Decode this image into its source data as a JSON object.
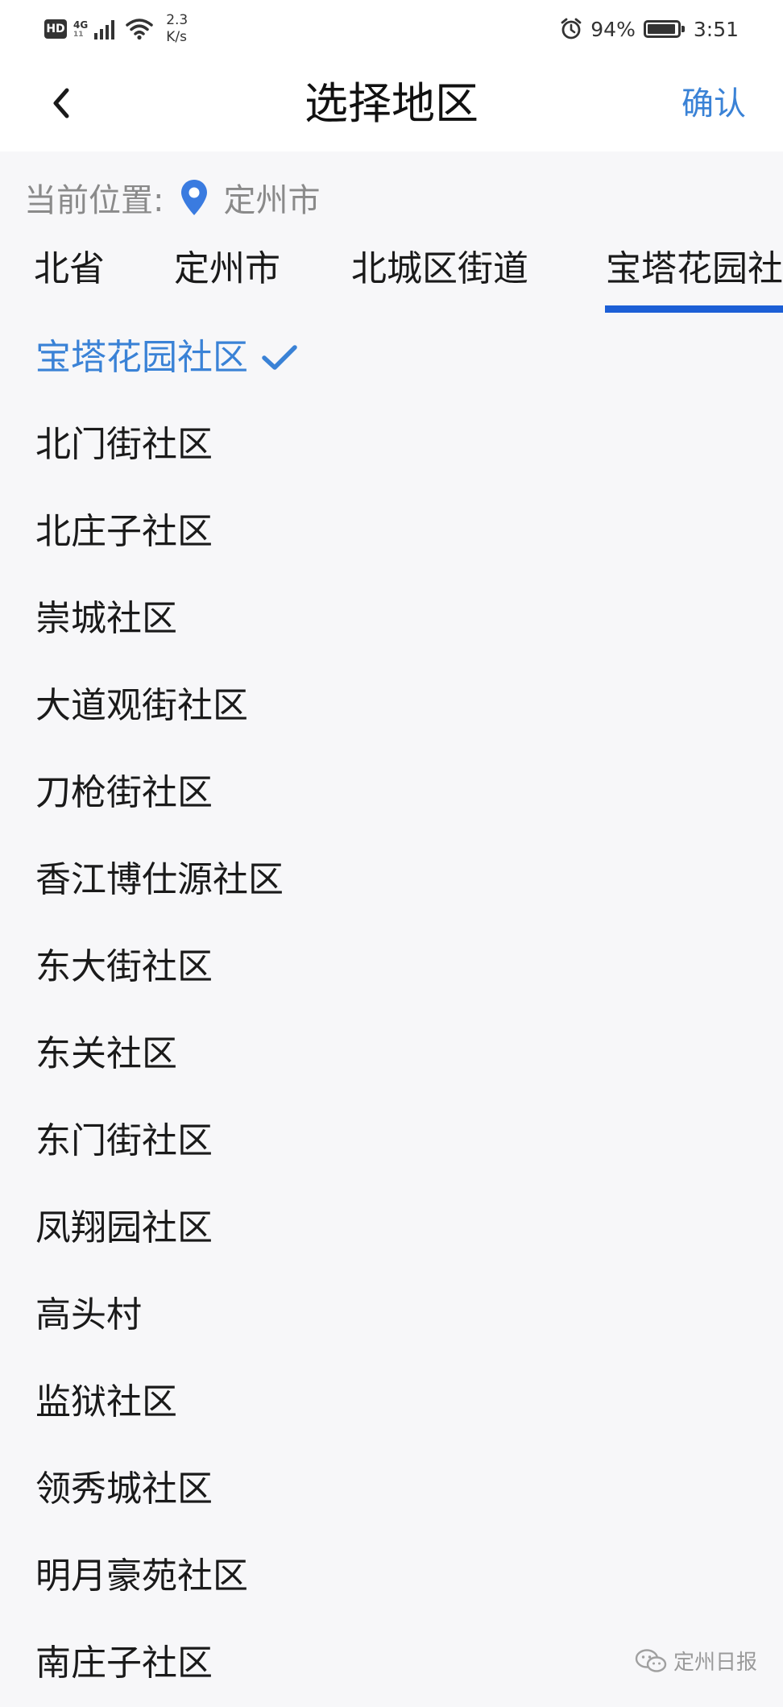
{
  "status_bar": {
    "hd": "HD",
    "net_type_top": "4G",
    "net_type_bottom": "11",
    "speed_value": "2.3",
    "speed_unit": "K/s",
    "battery_percent": "94%",
    "time": "3:51"
  },
  "nav": {
    "title": "选择地区",
    "confirm_label": "确认"
  },
  "location": {
    "label": "当前位置:",
    "value": "定州市"
  },
  "tabs": [
    {
      "label": "北省"
    },
    {
      "label": "定州市"
    },
    {
      "label": "北城区街道"
    },
    {
      "label": "宝塔花园社区"
    }
  ],
  "regions": [
    {
      "name": "宝塔花园社区",
      "selected": true
    },
    {
      "name": "北门街社区"
    },
    {
      "name": "北庄子社区"
    },
    {
      "name": "崇城社区"
    },
    {
      "name": "大道观街社区"
    },
    {
      "name": "刀枪街社区"
    },
    {
      "name": "香江博仕源社区"
    },
    {
      "name": "东大街社区"
    },
    {
      "name": "东关社区"
    },
    {
      "name": "东门街社区"
    },
    {
      "name": "凤翔园社区"
    },
    {
      "name": "高头村"
    },
    {
      "name": "监狱社区"
    },
    {
      "name": "领秀城社区"
    },
    {
      "name": "明月豪苑社区"
    },
    {
      "name": "南庄子社区"
    }
  ],
  "watermark": {
    "text": "定州日报",
    "icon": "wechat-icon"
  },
  "colors": {
    "accent": "#3a82d6",
    "tab_indicator": "#1c5fd6",
    "background": "#f7f7f9"
  },
  "icons": {
    "back": "chevron-left-icon",
    "location": "map-pin-icon",
    "selected": "check-icon"
  }
}
